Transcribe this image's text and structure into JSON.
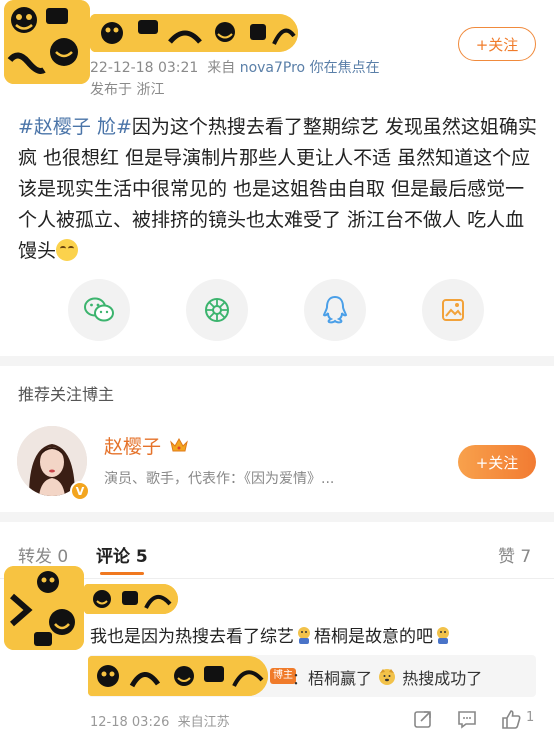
{
  "post": {
    "time": "22-12-18 03:21",
    "source_prefix": "来自",
    "device": "nova7Pro 你在焦点在",
    "location": "发布于 浙江",
    "follow_label": "+关注",
    "tag": "#赵樱子 尬#",
    "body": "因为这个热搜去看了整期综艺 发现虽然这姐确实疯 也很想红 但是导演制片那些人更让人不适 虽然知道这个应该是现实生活中很常见的 也是这姐咎由自取 但是最后感觉一个人被孤立、被排挤的镜头也太难受了 浙江台不做人 吃人血馒头"
  },
  "share": {
    "items": [
      "wechat-icon",
      "moments-icon",
      "qq-icon",
      "save-image-icon"
    ],
    "colors": {
      "wechat": "#3cb46e",
      "moments": "#3cb46e",
      "qq": "#4a9fe8",
      "save": "#f2a23a"
    }
  },
  "recommend": {
    "section_title": "推荐关注博主",
    "name": "赵樱子",
    "desc": "演员、歌手，代表作：《因为爱情》...",
    "verify_mark": "V",
    "follow_label": "+关注"
  },
  "tabs": {
    "repost": "转发 0",
    "comment": "评论 5",
    "like": "赞 7"
  },
  "comment": {
    "text_a": "我也是因为热搜去看了综艺",
    "text_b": "梧桐是故意的吧",
    "reply_badge": "博主",
    "reply_a": "：梧桐赢了",
    "reply_b": "热搜成功了",
    "time": "12-18 03:26",
    "source": "来自江苏",
    "like_count": "1"
  },
  "colors": {
    "accent": "#f07b2a",
    "link": "#4a74a8",
    "sticker": "#f7c341"
  }
}
